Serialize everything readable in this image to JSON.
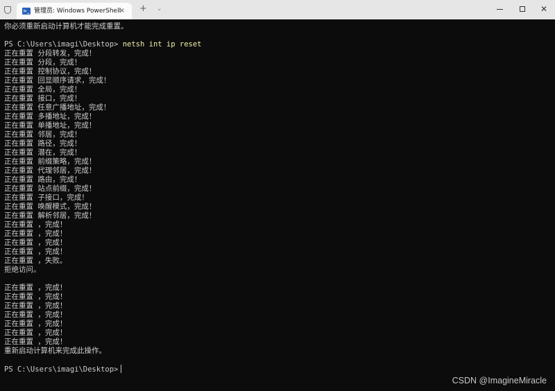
{
  "window": {
    "tab_title": "管理员: Windows PowerShell",
    "tab_icon": "powershell-icon",
    "tab_close": "×",
    "new_tab": "+",
    "tab_dropdown": "⌄",
    "close": "✕"
  },
  "terminal": {
    "prompt": "PS C:\\Users\\imagi\\Desktop> ",
    "command": "netsh int ip reset",
    "lines": [
      "你必须重新启动计算机才能完成重置。",
      "",
      "__CMD__",
      "正在重置 分段转发，完成！",
      "正在重置 分段，完成！",
      "正在重置 控制协议，完成！",
      "正在重置 回显顺序请求，完成！",
      "正在重置 全局，完成！",
      "正在重置 接口，完成！",
      "正在重置 任意广播地址，完成！",
      "正在重置 多播地址，完成！",
      "正在重置 单播地址，完成！",
      "正在重置 邻居，完成！",
      "正在重置 路径，完成！",
      "正在重置 潜在，完成！",
      "正在重置 前缀策略，完成！",
      "正在重置 代理邻居，完成！",
      "正在重置 路由，完成！",
      "正在重置 站点前缀，完成！",
      "正在重置 子接口，完成！",
      "正在重置 唤醒模式，完成！",
      "正在重置 解析邻居，完成！",
      "正在重置 ，完成！",
      "正在重置 ，完成！",
      "正在重置 ，完成！",
      "正在重置 ，完成！",
      "正在重置 ，失败。",
      "拒绝访问。",
      "",
      "正在重置 ，完成！",
      "正在重置 ，完成！",
      "正在重置 ，完成！",
      "正在重置 ，完成！",
      "正在重置 ，完成！",
      "正在重置 ，完成！",
      "正在重置 ，完成！",
      "重新启动计算机来完成此操作。",
      "",
      "__PROMPT__"
    ]
  },
  "colors": {
    "background": "#0c0c0c",
    "text": "#cccccc",
    "command": "#f2f0a6",
    "titlebar": "#e6e6e6"
  },
  "watermark": "CSDN @ImagineMiracle"
}
